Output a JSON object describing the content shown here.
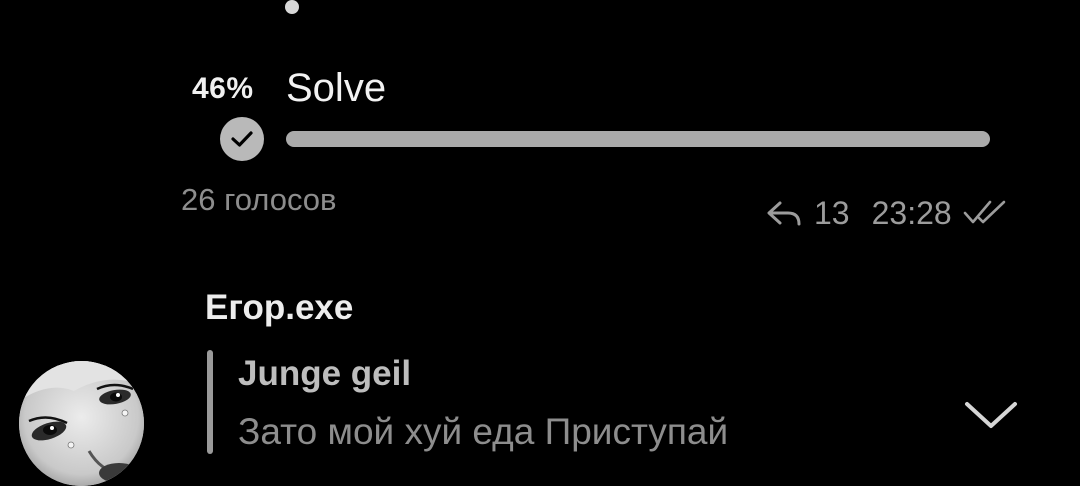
{
  "poll": {
    "option_percent": "46%",
    "option_text": "Solve",
    "option_fraction": 0.46,
    "votes_label": "26 голосов"
  },
  "message_meta": {
    "forwards": "13",
    "time": "23:28",
    "forward_icon": "share-arrow-icon",
    "status_icon": "double-check-icon"
  },
  "next_message": {
    "author": "Егор.exe",
    "reply_author": "Junge geil",
    "reply_text": "Зато мой хуй еда Приступай",
    "expand_icon": "chevron-down-icon"
  },
  "colors": {
    "background": "#000000",
    "text_primary": "#ededed",
    "text_secondary": "#8d8d8d",
    "poll_bar": "#aaaaaa"
  }
}
